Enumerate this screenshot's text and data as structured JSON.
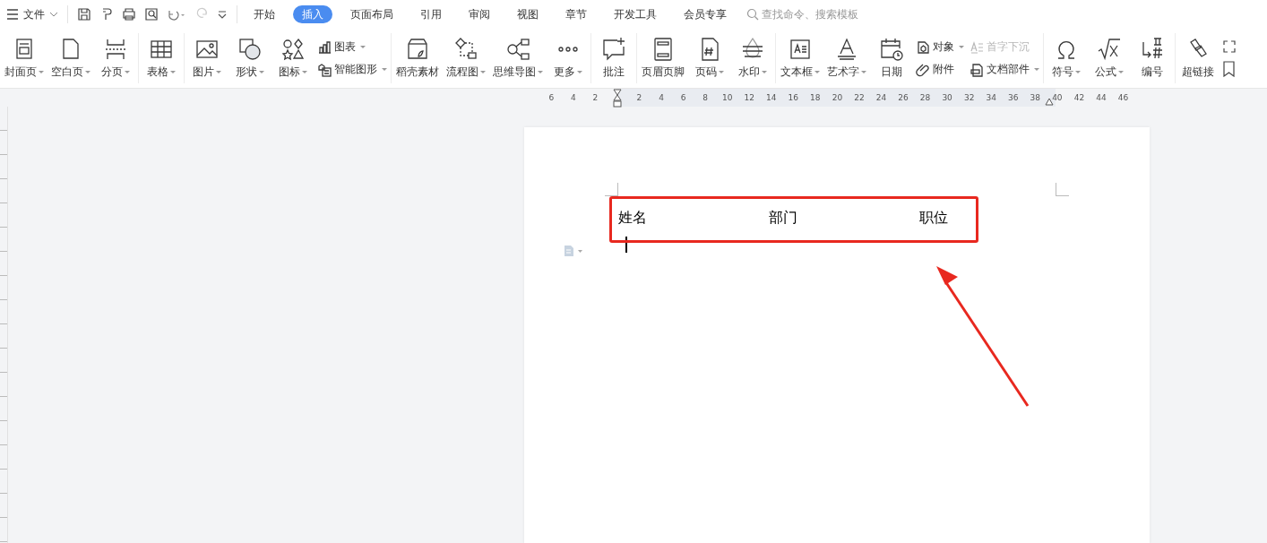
{
  "menu": {
    "label": "文件"
  },
  "tabs": [
    {
      "label": "开始",
      "selected": false
    },
    {
      "label": "插入",
      "selected": true
    },
    {
      "label": "页面布局",
      "selected": false
    },
    {
      "label": "引用",
      "selected": false
    },
    {
      "label": "审阅",
      "selected": false
    },
    {
      "label": "视图",
      "selected": false
    },
    {
      "label": "章节",
      "selected": false
    },
    {
      "label": "开发工具",
      "selected": false
    },
    {
      "label": "会员专享",
      "selected": false
    }
  ],
  "search": {
    "placeholder": "查找命令、搜索模板"
  },
  "ribbon_groups": [
    {
      "items": [
        {
          "kind": "large",
          "label": "封面页",
          "dropdown": true
        },
        {
          "kind": "large",
          "label": "空白页",
          "dropdown": true
        },
        {
          "kind": "large",
          "label": "分页",
          "dropdown": true
        }
      ]
    },
    {
      "items": [
        {
          "kind": "large",
          "label": "表格",
          "dropdown": true
        }
      ]
    },
    {
      "items": [
        {
          "kind": "large",
          "label": "图片",
          "dropdown": true
        },
        {
          "kind": "large",
          "label": "形状",
          "dropdown": true
        },
        {
          "kind": "large",
          "label": "图标",
          "dropdown": true
        },
        {
          "kind": "stack",
          "items": [
            {
              "label": "图表",
              "dropdown": true,
              "disabled": false
            },
            {
              "label": "智能图形",
              "dropdown": true,
              "disabled": false
            }
          ]
        }
      ]
    },
    {
      "items": [
        {
          "kind": "large",
          "label": "稻壳素材",
          "dropdown": false
        },
        {
          "kind": "large",
          "label": "流程图",
          "dropdown": true
        },
        {
          "kind": "large",
          "label": "思维导图",
          "dropdown": true
        },
        {
          "kind": "large",
          "label": "更多",
          "dropdown": true
        }
      ]
    },
    {
      "items": [
        {
          "kind": "large",
          "label": "批注",
          "dropdown": false
        }
      ]
    },
    {
      "items": [
        {
          "kind": "large",
          "label": "页眉页脚",
          "dropdown": false
        },
        {
          "kind": "large",
          "label": "页码",
          "dropdown": true
        },
        {
          "kind": "large",
          "label": "水印",
          "dropdown": true
        }
      ]
    },
    {
      "items": [
        {
          "kind": "large",
          "label": "文本框",
          "dropdown": true
        },
        {
          "kind": "large",
          "label": "艺术字",
          "dropdown": true
        },
        {
          "kind": "large",
          "label": "日期",
          "dropdown": false
        },
        {
          "kind": "stack",
          "items": [
            {
              "label": "对象",
              "dropdown": true,
              "disabled": false
            },
            {
              "label": "附件",
              "dropdown": false,
              "disabled": false
            }
          ]
        },
        {
          "kind": "stack",
          "items": [
            {
              "label": "首字下沉",
              "dropdown": false,
              "disabled": true
            },
            {
              "label": "文档部件",
              "dropdown": true,
              "disabled": false
            }
          ]
        }
      ]
    },
    {
      "items": [
        {
          "kind": "large",
          "label": "符号",
          "dropdown": true
        },
        {
          "kind": "large",
          "label": "公式",
          "dropdown": true
        },
        {
          "kind": "large",
          "label": "编号",
          "dropdown": false
        }
      ]
    },
    {
      "items": [
        {
          "kind": "large",
          "label": "超链接",
          "dropdown": false
        }
      ]
    }
  ],
  "ruler": {
    "left_numbers": [
      "6",
      "4",
      "2"
    ],
    "right_numbers": [
      "2",
      "4",
      "6",
      "8",
      "10",
      "12",
      "14",
      "16",
      "18",
      "20",
      "22",
      "24",
      "26",
      "28",
      "30",
      "32",
      "34",
      "36",
      "38",
      "40",
      "42",
      "44",
      "46"
    ]
  },
  "document": {
    "table_header": [
      "姓名",
      "部门",
      "职位"
    ]
  }
}
